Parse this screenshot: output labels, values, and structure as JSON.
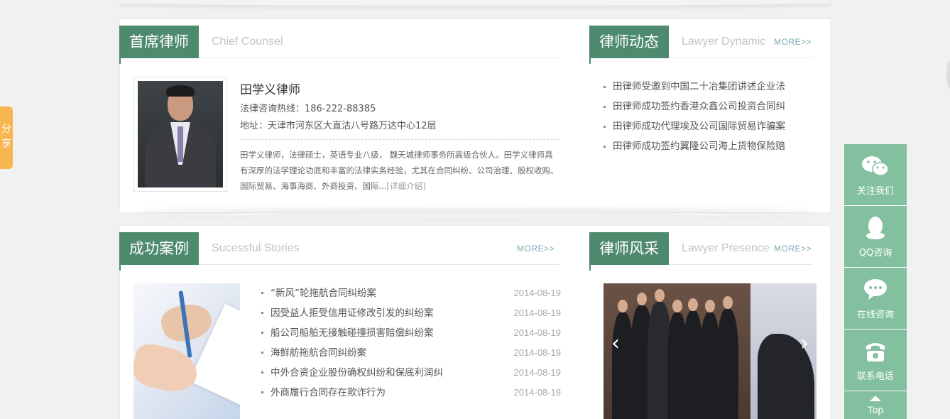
{
  "chief": {
    "title": "首席律师",
    "subtitle": "Chief Counsel",
    "name": "田学义律师",
    "hotline": "法律咨询热线：186-222-88385",
    "address": "地址：天津市河东区大直沽八号路万达中心12层",
    "bio": "田学义律师，法律硕士，英语专业八级， 魏天城律师事务所高级合伙人。田学义律师具有深厚的法学理论功底和丰富的法律实务经验，尤其在合同纠纷、公司治理、股权收购、国际贸易、海事海商、外商投资、国际...",
    "detail_link": "[详细介绍]"
  },
  "dynamic": {
    "title": "律师动态",
    "subtitle": "Lawyer Dynamic",
    "more": "MORE>>",
    "items": [
      "田律师受邀到中国二十冶集团讲述企业法",
      "田律师成功签约香港众鑫公司投资合同纠",
      "田律师成功代理埃及公司国际贸易诈骗案",
      "田律师成功签约翼隆公司海上货物保险赔"
    ]
  },
  "cases": {
    "title": "成功案例",
    "subtitle": "Sucessful Stories",
    "more": "MORE>>",
    "items": [
      {
        "title": "“新风”轮拖航合同纠纷案",
        "date": "2014-08-19"
      },
      {
        "title": "因受益人拒受信用证修改引发的纠纷案",
        "date": "2014-08-19"
      },
      {
        "title": "船公司船舶无接触碰撞损害赔偿纠纷案",
        "date": "2014-08-19"
      },
      {
        "title": "海鲜舫拖航合同纠纷案",
        "date": "2014-08-19"
      },
      {
        "title": "中外合资企业股份确权纠纷和保底利润纠",
        "date": "2014-08-19"
      },
      {
        "title": "外商履行合同存在欺诈行为",
        "date": "2014-08-19"
      }
    ]
  },
  "presence": {
    "title": "律师风采",
    "subtitle": "Lawyer Presence",
    "more": "MORE>>",
    "prev": "‹",
    "next": "›"
  },
  "share": {
    "label": "分享"
  },
  "float_bar": {
    "items": [
      {
        "label": "关注我们",
        "icon": "wechat-icon"
      },
      {
        "label": "QQ咨询",
        "icon": "qq-icon"
      },
      {
        "label": "在线咨询",
        "icon": "chat-bubble-icon"
      },
      {
        "label": "联系电话",
        "icon": "phone-icon"
      }
    ],
    "top_label": "Top"
  },
  "colors": {
    "accent": "#4e8a6e",
    "float": "#83c0a0",
    "share": "#f7b64e"
  }
}
